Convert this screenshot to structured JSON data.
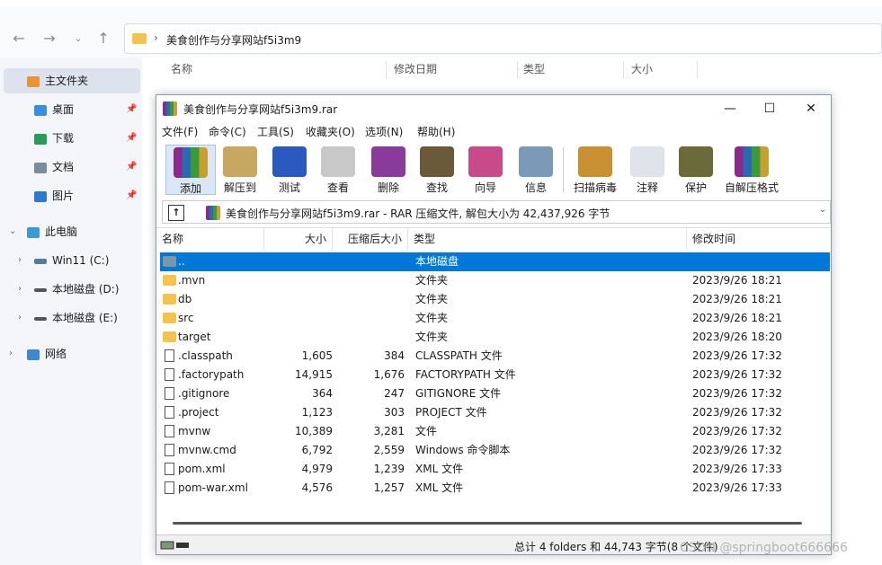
{
  "explorer": {
    "address_path": "美食创作与分享网站f5i3m9",
    "columns": [
      "名称",
      "修改日期",
      "类型",
      "大小"
    ],
    "sidebar": [
      {
        "label": "主文件夹",
        "icon": "home-icon"
      },
      {
        "label": "桌面",
        "icon": "desktop-icon"
      },
      {
        "label": "下载",
        "icon": "download-icon"
      },
      {
        "label": "文档",
        "icon": "document-icon"
      },
      {
        "label": "图片",
        "icon": "picture-icon"
      },
      {
        "label": "此电脑",
        "icon": "computer-icon"
      },
      {
        "label": "Win11 (C:)",
        "icon": "drive-icon"
      },
      {
        "label": "本地磁盘 (D:)",
        "icon": "drive-icon"
      },
      {
        "label": "本地磁盘 (E:)",
        "icon": "drive-icon"
      },
      {
        "label": "网络",
        "icon": "network-icon"
      }
    ]
  },
  "rar": {
    "title": "美食创作与分享网站f5i3m9.rar",
    "menu": [
      "文件(F)",
      "命令(C)",
      "工具(S)",
      "收藏夹(O)",
      "选项(N)",
      "帮助(H)"
    ],
    "toolbar": [
      "添加",
      "解压到",
      "测试",
      "查看",
      "删除",
      "查找",
      "向导",
      "信息",
      "扫描病毒",
      "注释",
      "保护",
      "自解压格式"
    ],
    "path": "美食创作与分享网站f5i3m9.rar - RAR 压缩文件, 解包大小为 42,437,926 字节",
    "columns": [
      "名称",
      "大小",
      "压缩后大小",
      "类型",
      "修改时间"
    ],
    "files": [
      {
        "name": "..",
        "size": "",
        "packed": "",
        "type": "本地磁盘",
        "modified": "",
        "icon": "up"
      },
      {
        "name": ".mvn",
        "size": "",
        "packed": "",
        "type": "文件夹",
        "modified": "2023/9/26 18:21",
        "icon": "folder"
      },
      {
        "name": "db",
        "size": "",
        "packed": "",
        "type": "文件夹",
        "modified": "2023/9/26 18:21",
        "icon": "folder"
      },
      {
        "name": "src",
        "size": "",
        "packed": "",
        "type": "文件夹",
        "modified": "2023/9/26 18:21",
        "icon": "folder"
      },
      {
        "name": "target",
        "size": "",
        "packed": "",
        "type": "文件夹",
        "modified": "2023/9/26 18:20",
        "icon": "folder"
      },
      {
        "name": ".classpath",
        "size": "1,605",
        "packed": "384",
        "type": "CLASSPATH 文件",
        "modified": "2023/9/26 17:32",
        "icon": "file"
      },
      {
        "name": ".factorypath",
        "size": "14,915",
        "packed": "1,676",
        "type": "FACTORYPATH 文件",
        "modified": "2023/9/26 17:32",
        "icon": "file"
      },
      {
        "name": ".gitignore",
        "size": "364",
        "packed": "247",
        "type": "GITIGNORE 文件",
        "modified": "2023/9/26 17:32",
        "icon": "file"
      },
      {
        "name": ".project",
        "size": "1,123",
        "packed": "303",
        "type": "PROJECT 文件",
        "modified": "2023/9/26 17:32",
        "icon": "file"
      },
      {
        "name": "mvnw",
        "size": "10,389",
        "packed": "3,281",
        "type": "文件",
        "modified": "2023/9/26 17:32",
        "icon": "file"
      },
      {
        "name": "mvnw.cmd",
        "size": "6,792",
        "packed": "2,559",
        "type": "Windows 命令脚本",
        "modified": "2023/9/26 17:32",
        "icon": "file"
      },
      {
        "name": "pom.xml",
        "size": "4,979",
        "packed": "1,239",
        "type": "XML 文件",
        "modified": "2023/9/26 17:33",
        "icon": "file"
      },
      {
        "name": "pom-war.xml",
        "size": "4,576",
        "packed": "1,257",
        "type": "XML 文件",
        "modified": "2023/9/26 17:33",
        "icon": "file"
      }
    ],
    "status": "总计 4 folders 和 44,743 字节(8 个文件)"
  },
  "watermark": "CSDN @springboot666666"
}
